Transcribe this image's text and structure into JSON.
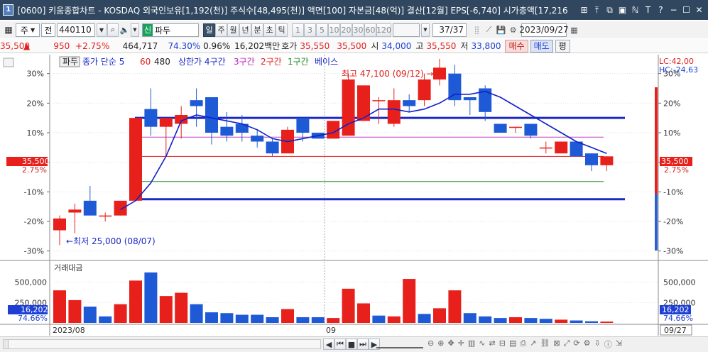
{
  "titlebar": {
    "window_number": "1",
    "title": "[0600] 키움종합차트 - KOSDAQ 외국인보유[1,192(천)] 주식수[48,495(천)] 액면[100] 자본금[48(억)] 결산[12월] EPS[-6,740] 시가총액[17,216",
    "buttons": [
      "⊞",
      "⤒",
      "⧉",
      "▣",
      "ℕ",
      "T",
      "?",
      "−",
      "☐",
      "✕"
    ]
  },
  "toolbar": {
    "type_select": "주",
    "all_label": "전",
    "code": "440110",
    "name_prefix": "신",
    "stock_name": "파두",
    "periods": [
      "일",
      "주",
      "월",
      "년",
      "분",
      "초",
      "틱"
    ],
    "selected_period": "일",
    "intervals": [
      "1",
      "3",
      "5",
      "10",
      "20",
      "30",
      "60",
      "120"
    ],
    "page": "37/37",
    "date": "2023/09/27"
  },
  "quote": {
    "price": "35,500",
    "price_arrow": "▲",
    "change": "950",
    "change_pct": "+2.75%",
    "volume": "464,717",
    "ratio": "74.30%",
    "turnover": "0.96%",
    "amount": "16,202백만",
    "bid_label": "호가",
    "ask": "35,550",
    "bid": "35,500",
    "open_label": "시",
    "open": "34,000",
    "high_label": "고",
    "high": "35,550",
    "low_label": "저",
    "low": "33,800",
    "buy_label": "매수",
    "sell_label": "매도",
    "eval_label": "평"
  },
  "legend": {
    "stock": "파두",
    "ma": "종가 단순 5",
    "ma60": "60",
    "ma480": "480",
    "upper": "상한가 4구간",
    "z3": "3구간",
    "z2": "2구간",
    "z1": "1구간",
    "base": "베이스"
  },
  "right_info": {
    "lc": "LC:42,00",
    "hc": "HC:-24,63"
  },
  "annotations": {
    "max": "최고 47,100 (09/12) →",
    "min": "←최저 25,000 (08/07)"
  },
  "axis": {
    "price_ticks": [
      "30%",
      "20%",
      "10%",
      "0%",
      "-10%",
      "-20%",
      "-30%"
    ],
    "price_tag": "35,500",
    "pct_tag": "2.75%",
    "vol_title": "거래대금",
    "vol_ticks": [
      "500,000",
      "250,000"
    ],
    "vol_tag": "16,202",
    "vol_pct": "74.66%",
    "months": [
      "2023/08",
      "09"
    ],
    "date_tag": "09/27"
  },
  "colors": {
    "up": "#e8201c",
    "down": "#1e59d6",
    "ma": "#1020c8",
    "band": "#1a28c8"
  },
  "chart_data": {
    "type": "candlestick",
    "y_unit": "% vs base price",
    "ylim": [
      -32,
      34
    ],
    "candles": [
      {
        "o": -23,
        "h": -18,
        "c": -19,
        "l": -28
      },
      {
        "o": -17,
        "h": -14,
        "c": -16,
        "l": -24
      },
      {
        "o": -13,
        "h": -8,
        "c": -18,
        "l": -18
      },
      {
        "o": -18,
        "h": -17,
        "c": -18,
        "l": -20
      },
      {
        "o": -18,
        "h": -14,
        "c": -13,
        "l": -18
      },
      {
        "o": -13,
        "h": 15,
        "c": 15,
        "l": -13
      },
      {
        "o": 18,
        "h": 25,
        "c": 12,
        "l": 9
      },
      {
        "o": 12,
        "h": 15,
        "c": 15,
        "l": 2
      },
      {
        "o": 13,
        "h": 19,
        "c": 16,
        "l": 8
      },
      {
        "o": 21,
        "h": 25,
        "c": 19,
        "l": 12
      },
      {
        "o": 22,
        "h": 22,
        "c": 10,
        "l": 6
      },
      {
        "o": 12,
        "h": 17,
        "c": 9,
        "l": 7
      },
      {
        "o": 13,
        "h": 16,
        "c": 10,
        "l": 7
      },
      {
        "o": 9,
        "h": 11,
        "c": 7,
        "l": 5
      },
      {
        "o": 7,
        "h": 8,
        "c": 3,
        "l": 2
      },
      {
        "o": 3,
        "h": 12,
        "c": 11,
        "l": 3
      },
      {
        "o": 15,
        "h": 15,
        "c": 10,
        "l": 7
      },
      {
        "o": 10,
        "h": 10,
        "c": 8,
        "l": 8
      },
      {
        "o": 8,
        "h": 13,
        "c": 14,
        "l": 8
      },
      {
        "o": 9,
        "h": 30,
        "c": 28,
        "l": 9
      },
      {
        "o": 14,
        "h": 23,
        "c": 26,
        "l": 14
      },
      {
        "o": 21,
        "h": 22,
        "c": 21,
        "l": 13
      },
      {
        "o": 13,
        "h": 25,
        "c": 21,
        "l": 12
      },
      {
        "o": 21,
        "h": 23,
        "c": 19,
        "l": 17
      },
      {
        "o": 21,
        "h": 30,
        "c": 28,
        "l": 19
      },
      {
        "o": 28,
        "h": 35,
        "c": 32,
        "l": 26
      },
      {
        "o": 30,
        "h": 33,
        "c": 21,
        "l": 19
      },
      {
        "o": 22,
        "h": 22,
        "c": 21,
        "l": 16
      },
      {
        "o": 25,
        "h": 26,
        "c": 17,
        "l": 14
      },
      {
        "o": 13,
        "h": 13,
        "c": 10,
        "l": 10
      },
      {
        "o": 12,
        "h": 12,
        "c": 12,
        "l": 10
      },
      {
        "o": 13,
        "h": 13,
        "c": 9,
        "l": 8
      },
      {
        "o": 5,
        "h": 7,
        "c": 5,
        "l": 3
      },
      {
        "o": 3,
        "h": 7,
        "c": 7,
        "l": 3
      },
      {
        "o": 7,
        "h": 7,
        "c": 2,
        "l": 2
      },
      {
        "o": 3,
        "h": 3,
        "c": -1,
        "l": -3
      },
      {
        "o": -1,
        "h": 2,
        "c": 2,
        "l": -3
      }
    ],
    "ma5": [
      null,
      null,
      null,
      null,
      -16,
      -13,
      -7,
      2,
      14,
      16,
      15,
      14,
      13,
      11,
      8,
      7,
      8,
      9,
      10,
      13,
      15,
      18,
      18,
      17,
      18,
      20,
      23,
      23,
      24,
      22,
      19,
      16,
      13,
      10,
      7,
      5,
      3
    ],
    "upper_band": 15,
    "lower_band": -12.5,
    "line_3": 8.5,
    "line_2": 2,
    "line_1": -6.5,
    "volume": [
      400000,
      280000,
      200000,
      80000,
      230000,
      520000,
      620000,
      330000,
      370000,
      230000,
      130000,
      120000,
      100000,
      100000,
      70000,
      170000,
      70000,
      70000,
      60000,
      420000,
      240000,
      90000,
      80000,
      540000,
      110000,
      180000,
      400000,
      120000,
      80000,
      60000,
      70000,
      60000,
      50000,
      40000,
      30000,
      20000,
      16202
    ],
    "volume_up": [
      true,
      true,
      false,
      false,
      true,
      true,
      false,
      true,
      true,
      false,
      false,
      false,
      false,
      false,
      false,
      true,
      false,
      false,
      true,
      true,
      true,
      false,
      true,
      true,
      false,
      true,
      true,
      false,
      false,
      false,
      true,
      false,
      false,
      true,
      false,
      false,
      true
    ]
  }
}
